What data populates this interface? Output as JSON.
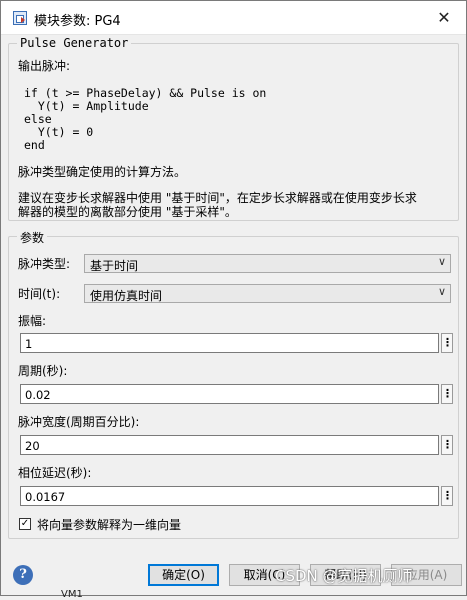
{
  "window": {
    "title": "模块参数: PG4",
    "close_glyph": "✕"
  },
  "description": {
    "block_name": "Pulse Generator",
    "line1": "输出脉冲:",
    "code": "if (t >= PhaseDelay) && Pulse is on\n  Y(t) = Amplitude\nelse\n  Y(t) = 0\nend",
    "line2": "脉冲类型确定使用的计算方法。",
    "line3a": "建议在变步长求解器中使用 \"基于时间\"，在定步长求解器或在使用变步长求",
    "line3b": "解器的模型的离散部分使用 \"基于采样\"。"
  },
  "params": {
    "group_title": "参数",
    "pulse_type_label": "脉冲类型:",
    "pulse_type_value": "基于时间",
    "time_label": "时间(t):",
    "time_value": "使用仿真时间",
    "amplitude_label": "振幅:",
    "amplitude_value": "1",
    "period_label": "周期(秒):",
    "period_value": "0.02",
    "pulse_width_label": "脉冲宽度(周期百分比):",
    "pulse_width_value": "20",
    "phase_delay_label": "相位延迟(秒):",
    "phase_delay_value": "0.0167",
    "vector_checkbox_label": "将向量参数解释为一维向量",
    "vector_checkbox_checked": true,
    "menu_glyph": "⋮",
    "dropdown_glyph": "∨"
  },
  "footer": {
    "help_glyph": "?",
    "ok_label": "确定(O)",
    "cancel_label": "取消(C)",
    "help_label": "帮助(H)",
    "apply_label": "应用(A)",
    "watermark": "CSDN @宽据机厕师",
    "background_text": "VM1"
  },
  "colors": {
    "accent": "#0078d7",
    "help_icon": "#3d6fb8"
  }
}
